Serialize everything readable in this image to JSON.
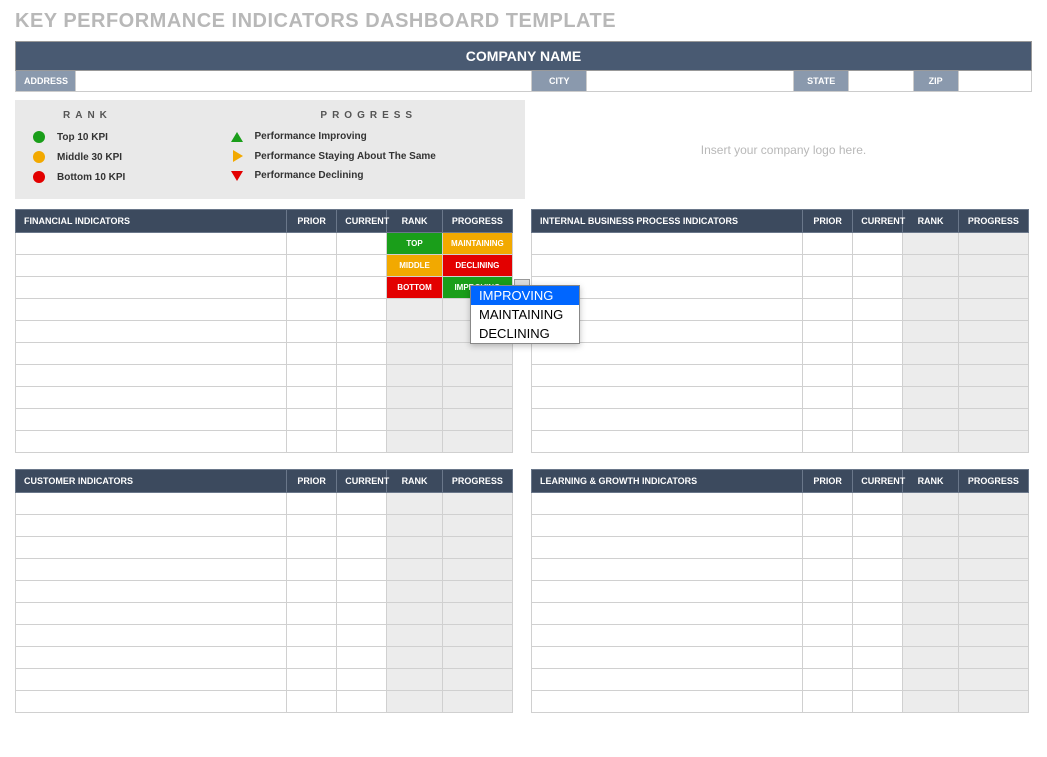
{
  "title": "KEY PERFORMANCE INDICATORS DASHBOARD TEMPLATE",
  "company_bar": "COMPANY NAME",
  "labels": {
    "address": "ADDRESS",
    "city": "CITY",
    "state": "STATE",
    "zip": "ZIP"
  },
  "logo_placeholder": "Insert your company logo here.",
  "legend": {
    "rank_head": "RANK",
    "progress_head": "PROGRESS",
    "rank": [
      "Top 10 KPI",
      "Middle 30 KPI",
      "Bottom 10 KPI"
    ],
    "progress": [
      "Performance Improving",
      "Performance Staying About The Same",
      "Performance Declining"
    ]
  },
  "cols": {
    "prior": "PRIOR",
    "current": "CURRENT",
    "rank": "RANK",
    "progress": "PROGRESS"
  },
  "sections": {
    "financial": "FINANCIAL INDICATORS",
    "internal": "INTERNAL BUSINESS PROCESS INDICATORS",
    "customer": "CUSTOMER INDICATORS",
    "learning": "LEARNING & GROWTH INDICATORS"
  },
  "financial_rows": [
    {
      "rank": "TOP",
      "progress": "MAINTAINING"
    },
    {
      "rank": "MIDDLE",
      "progress": "DECLINING"
    },
    {
      "rank": "BOTTOM",
      "progress": "IMPROVING"
    }
  ],
  "dropdown": {
    "options": [
      "IMPROVING",
      "MAINTAINING",
      "DECLINING"
    ],
    "selected": "IMPROVING"
  }
}
